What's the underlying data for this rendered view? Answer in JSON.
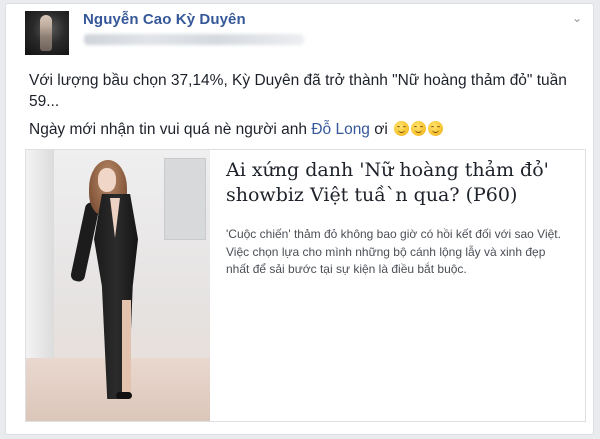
{
  "post": {
    "author": "Nguyễn Cao Kỳ Duyên",
    "options_icon": "chevron-down-icon",
    "text_line1": "Với lượng bầu chọn 37,14%, Kỳ Duyên đã trở thành \"Nữ hoàng thảm đỏ\" tuần 59...",
    "text_line2_prefix": "Ngày mới nhận tin vui quá nè người anh ",
    "mention": "Đỗ Long",
    "text_line2_suffix": " ơi",
    "emoji_count": 3,
    "emoji_icon": "smiling-face-emoji-icon"
  },
  "link_card": {
    "title": "Ai xứng danh 'Nữ hoàng thảm đỏ' showbiz Việt tuầ`n qua? (P60)",
    "description": "'Cuộc chiến' thảm đỏ không bao giờ có hồi kết đối với sao Việt. Việc chọn lựa cho mình những bộ cánh lộng lẫy và xinh đẹp nhất để sải bước tại sự kiện là điều bắt buộc."
  },
  "colors": {
    "author": "#365899",
    "body_text": "#1d2129",
    "mention": "#365899",
    "background": "#e9ebee"
  }
}
